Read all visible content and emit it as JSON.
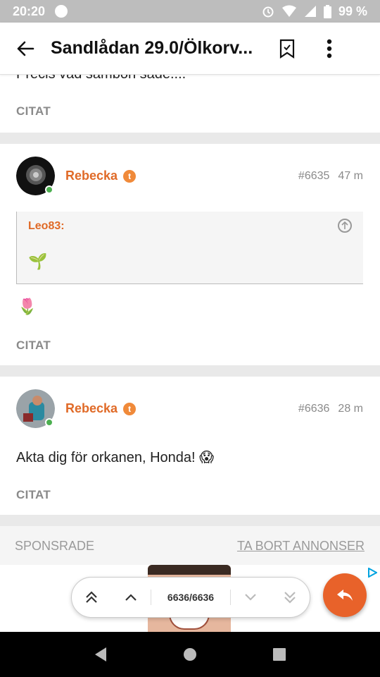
{
  "status": {
    "time": "20:20",
    "battery": "99 %"
  },
  "appbar": {
    "title": "Sandlådan 29.0/Ölkorv..."
  },
  "posts": [
    {
      "snippet": "Precis vad sambon sade....",
      "citat": "CITAT"
    },
    {
      "author": "Rebecka",
      "badge": "t",
      "number": "#6635",
      "age": "47 m",
      "quote": {
        "author": "Leo83:",
        "content": "🌱"
      },
      "content": "🌷",
      "citat": "CITAT"
    },
    {
      "author": "Rebecka",
      "badge": "t",
      "number": "#6636",
      "age": "28 m",
      "content": "Akta dig för orkanen, Honda! 😱",
      "citat": "CITAT"
    }
  ],
  "sponsor": {
    "label": "SPONSRADE",
    "remove": "TA BORT ANNONSER"
  },
  "nav": {
    "count": "6636/6636"
  },
  "colors": {
    "accent": "#e8622a",
    "author": "#e06a27",
    "online": "#4caf50"
  }
}
